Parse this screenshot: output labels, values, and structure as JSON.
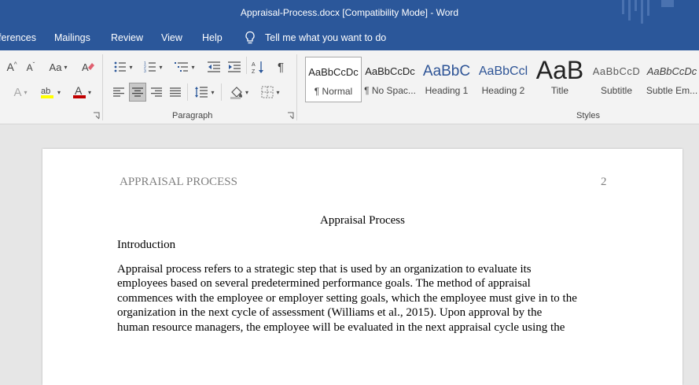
{
  "window": {
    "title": "Appraisal-Process.docx [Compatibility Mode]  -  Word"
  },
  "tabs": [
    {
      "label": "ferences"
    },
    {
      "label": "Mailings"
    },
    {
      "label": "Review"
    },
    {
      "label": "View"
    },
    {
      "label": "Help"
    }
  ],
  "tell_me": "Tell me what you want to do",
  "ribbon": {
    "paragraph_label": "Paragraph",
    "styles_label": "Styles",
    "styles": [
      {
        "preview": "AaBbCcDc",
        "name": "¶ Normal"
      },
      {
        "preview": "AaBbCcDc",
        "name": "¶ No Spac..."
      },
      {
        "preview": "AaBbC",
        "name": "Heading 1"
      },
      {
        "preview": "AaBbCcl",
        "name": "Heading 2"
      },
      {
        "preview": "AaB",
        "name": "Title"
      },
      {
        "preview": "AaBbCcD",
        "name": "Subtitle"
      },
      {
        "preview": "AaBbCcDc",
        "name": "Subtle Em..."
      }
    ],
    "colors": {
      "highlight": "#ffff00",
      "font_color": "#c00000"
    }
  },
  "document": {
    "header_left": "APPRAISAL PROCESS",
    "page_number": "2",
    "title": "Appraisal Process",
    "section": "Introduction",
    "lines": [
      "Appraisal process refers to a strategic step that is used by an organization to evaluate its",
      "employees based on several predetermined performance goals. The method of appraisal",
      "commences with the employee or employer setting goals, which the employee must give in to the",
      "organization in the next cycle of assessment (Williams et al., 2015). Upon approval by the",
      "human resource managers, the employee will be evaluated in the next appraisal cycle using the"
    ]
  },
  "icons": {
    "tell_me": "lightbulb-icon",
    "grow_font": "grow-font-icon",
    "shrink_font": "shrink-font-icon",
    "change_case": "change-case-icon",
    "clear_format": "clear-formatting-icon",
    "bullets": "bullets-icon",
    "numbering": "numbering-icon",
    "multilevel": "multilevel-list-icon",
    "decrease_indent": "decrease-indent-icon",
    "increase_indent": "increase-indent-icon",
    "sort": "sort-icon",
    "show_marks": "pilcrow-icon",
    "align_left": "align-left-icon",
    "center": "align-center-icon",
    "align_right": "align-right-icon",
    "justify": "justify-icon",
    "line_spacing": "line-spacing-icon",
    "shading": "shading-icon",
    "borders": "borders-icon"
  }
}
